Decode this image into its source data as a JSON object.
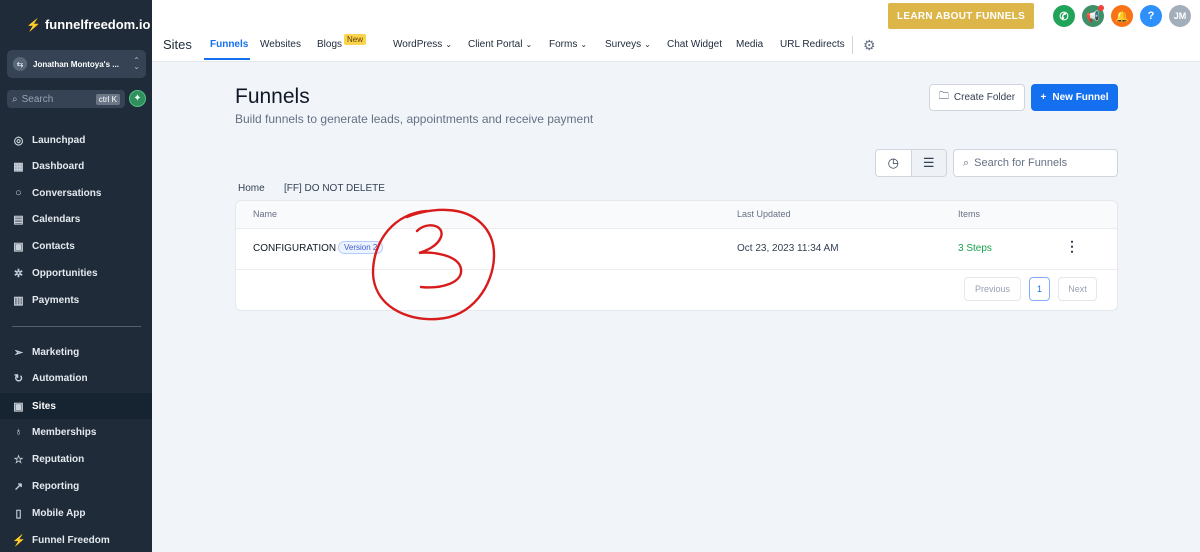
{
  "brand": {
    "name": "funnelfreedom.io"
  },
  "account": {
    "name": "Jonathan Montoya's ..."
  },
  "search": {
    "placeholder": "Search",
    "shortcut": "ctrl K"
  },
  "sidebar": {
    "items": [
      {
        "label": "Launchpad",
        "icon": "rocket-icon"
      },
      {
        "label": "Dashboard",
        "icon": "dashboard-icon"
      },
      {
        "label": "Conversations",
        "icon": "chat-icon"
      },
      {
        "label": "Calendars",
        "icon": "calendar-icon"
      },
      {
        "label": "Contacts",
        "icon": "contacts-icon"
      },
      {
        "label": "Opportunities",
        "icon": "opportunities-icon"
      },
      {
        "label": "Payments",
        "icon": "payments-icon"
      },
      {
        "label": "Marketing",
        "icon": "send-icon"
      },
      {
        "label": "Automation",
        "icon": "automation-icon"
      },
      {
        "label": "Sites",
        "icon": "sites-icon",
        "active": true
      },
      {
        "label": "Memberships",
        "icon": "award-icon"
      },
      {
        "label": "Reputation",
        "icon": "star-icon"
      },
      {
        "label": "Reporting",
        "icon": "chart-icon"
      },
      {
        "label": "Mobile App",
        "icon": "mobile-icon"
      },
      {
        "label": "Funnel Freedom",
        "icon": "bolt-icon"
      }
    ]
  },
  "topbar": {
    "section_title": "Sites",
    "tabs": [
      {
        "label": "Funnels",
        "active": true
      },
      {
        "label": "Websites"
      },
      {
        "label": "Blogs",
        "badge": "New"
      },
      {
        "label": "WordPress"
      },
      {
        "label": "Client Portal"
      },
      {
        "label": "Forms"
      },
      {
        "label": "Surveys"
      },
      {
        "label": "Chat Widget"
      },
      {
        "label": "Media"
      },
      {
        "label": "URL Redirects"
      }
    ],
    "learn_button": "LEARN ABOUT FUNNELS",
    "avatar_initials": "JM",
    "help_label": "?"
  },
  "main": {
    "title": "Funnels",
    "subtitle": "Build funnels to generate leads, appointments and receive payment",
    "create_folder_label": "Create Folder",
    "new_funnel_label": "New Funnel",
    "search_placeholder": "Search for Funnels",
    "breadcrumb": [
      "Home",
      "[FF] DO NOT DELETE"
    ],
    "table": {
      "columns": [
        "Name",
        "Last Updated",
        "Items"
      ],
      "rows": [
        {
          "name": "CONFIGURATION",
          "version": "Version 2",
          "last_updated": "Oct 23, 2023 11:34 AM",
          "items": "3 Steps"
        }
      ]
    },
    "pagination": {
      "previous": "Previous",
      "page": "1",
      "next": "Next"
    }
  },
  "colors": {
    "accent": "#1570ef",
    "sidebar_bg": "#1f2b38",
    "learn_button": "#ddb64a",
    "annotation": "#d81b1b"
  }
}
